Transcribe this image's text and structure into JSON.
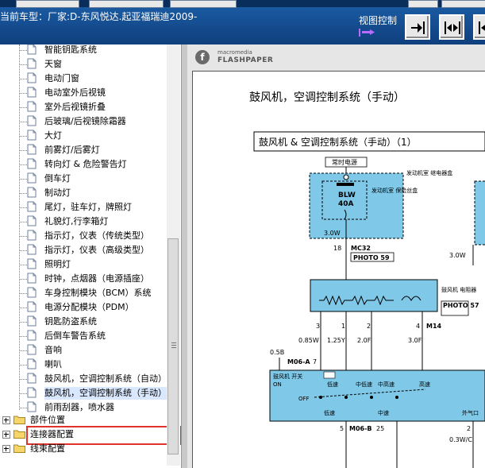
{
  "header": {
    "vehicle_title": "当前车型：厂家:D-东风悦达.起亚福瑞迪2009-",
    "view_control_label": "视图控制"
  },
  "tree": {
    "items": [
      {
        "label": "智能钥匙系统"
      },
      {
        "label": "天窗"
      },
      {
        "label": "电动门窗"
      },
      {
        "label": "电动室外后视镜"
      },
      {
        "label": "室外后视镜折叠"
      },
      {
        "label": "后玻璃/后视镜除霜器"
      },
      {
        "label": "大灯"
      },
      {
        "label": "前雾灯/后雾灯"
      },
      {
        "label": "转向灯 & 危险警告灯"
      },
      {
        "label": "倒车灯"
      },
      {
        "label": "制动灯"
      },
      {
        "label": "尾灯，驻车灯，牌照灯"
      },
      {
        "label": "礼貌灯,行李箱灯"
      },
      {
        "label": "指示灯，仪表（传统类型）"
      },
      {
        "label": "指示灯，仪表（高级类型）"
      },
      {
        "label": "照明灯"
      },
      {
        "label": "时钟，点烟器（电源插座）"
      },
      {
        "label": "车身控制模块（BCM）系统"
      },
      {
        "label": "电源分配模块（PDM）"
      },
      {
        "label": "钥匙防盗系统"
      },
      {
        "label": "后倒车警告系统"
      },
      {
        "label": "音响"
      },
      {
        "label": "喇叭"
      },
      {
        "label": "鼓风机，空调控制系统（自动）"
      },
      {
        "label": "鼓风机，空调控制系统（手动）",
        "selected": true
      },
      {
        "label": "前雨刮器，喷水器"
      }
    ],
    "folders": [
      {
        "label": "部件位置"
      },
      {
        "label": "连接器配置"
      },
      {
        "label": "线束配置"
      }
    ]
  },
  "viewer": {
    "logo_small": "macromedia",
    "logo_big": "FLASHPAPER",
    "logo_mark": "f",
    "page_title": "鼓风机，空调控制系统（手动）",
    "page_subtitle": "鼓风机 & 空调控制系统（手动）（1）",
    "diagram": {
      "hot_label": "常时电源",
      "fuse_name": "BLW",
      "fuse_amp": "40A",
      "fuse_note": "发动机室 保险丝盒",
      "fuse_note2": "发动机室 继电器盒",
      "wire_1": "3.0W",
      "wire_2": "3.0W",
      "pin_18": "18",
      "conn_mc32": "MC32",
      "photo_59": "PHOTO 59",
      "resistor_label": "鼓风机 电阻器",
      "photo_57": "PHOTO 57",
      "conn_m14": "M14",
      "pins_top": [
        "3",
        "1",
        "2",
        "4"
      ],
      "wires_mid": [
        "0.85W",
        "1.25Y",
        "2.0F",
        "3.0F"
      ],
      "wire_05b": "0.5B",
      "conn_m06a": "M06-A",
      "pin_m06a": "7",
      "switch_title": "鼓风机 开关",
      "switch_on": "ON",
      "switch_off": "OFF",
      "sw_low": "低速",
      "sw_midlow": "中低速",
      "sw_midhigh": "中高速",
      "sw_high": "高速",
      "sw_lo_text": "低速",
      "sw_mid_text": "中速",
      "sw_aux": "外气口",
      "conn_m06b": "M06-B",
      "pin_5": "5",
      "pin_25": "25",
      "pin_2": "2",
      "wire_03wc": "0.3W/C"
    }
  }
}
